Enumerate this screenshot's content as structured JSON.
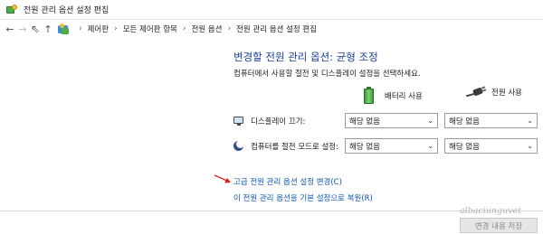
{
  "window": {
    "title": "전원 관리 옵션 설정 편집"
  },
  "nav": {
    "breadcrumbs": [
      "제어판",
      "모든 제어판 항목",
      "전원 옵션",
      "전원 관리 옵션 설정 편집"
    ]
  },
  "main": {
    "heading": "변경할 전원 관리 옵션: 균형 조정",
    "subtext": "컴퓨터에서 사용할 절전 및 디스플레이 설정을 선택하세요.",
    "columns": {
      "battery_label": "배터리 사용",
      "plugged_label": "전원 사용"
    },
    "settings": [
      {
        "label": "디스플레이 끄기:",
        "battery_value": "해당 없음",
        "plugged_value": "해당 없음",
        "icon": "monitor-icon"
      },
      {
        "label": "컴퓨터를 절전 모드로 설정:",
        "battery_value": "해당 없음",
        "plugged_value": "해당 없음",
        "icon": "moon-icon"
      }
    ],
    "links": {
      "advanced": "고급 전원 관리 옵션 설정 변경(C)",
      "restore": "이 전원 관리 옵션을 기본 설정으로 복원(R)"
    }
  },
  "footer": {
    "save_label": "변경 내용 저장",
    "watermark": "albaciunguvet"
  },
  "colors": {
    "heading": "#1c3f95",
    "link": "#0a57b7",
    "annotation_arrow": "#e02020"
  }
}
